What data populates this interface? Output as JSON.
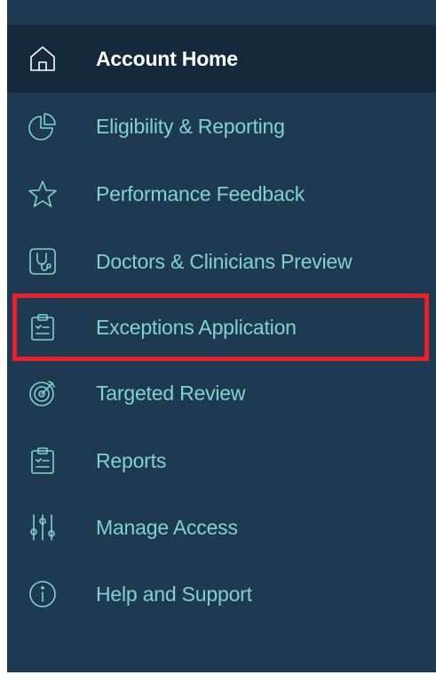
{
  "sidebar": {
    "items": [
      {
        "label": "Account Home",
        "icon": "home-icon",
        "active": true
      },
      {
        "label": "Eligibility & Reporting",
        "icon": "pie-chart-icon",
        "active": false
      },
      {
        "label": "Performance Feedback",
        "icon": "star-icon",
        "active": false
      },
      {
        "label": "Doctors & Clinicians Preview",
        "icon": "stethoscope-icon",
        "active": false
      },
      {
        "label": "Exceptions Application",
        "icon": "clipboard-icon",
        "active": false
      },
      {
        "label": "Targeted Review",
        "icon": "target-icon",
        "active": false
      },
      {
        "label": "Reports",
        "icon": "clipboard-icon",
        "active": false
      },
      {
        "label": "Manage Access",
        "icon": "sliders-icon",
        "active": false
      },
      {
        "label": "Help and Support",
        "icon": "info-icon",
        "active": false
      }
    ]
  },
  "colors": {
    "sidebar_bg": "#1e3a52",
    "active_bg": "#142a3c",
    "accent": "#7fd3cc",
    "highlight": "#e8202a"
  }
}
